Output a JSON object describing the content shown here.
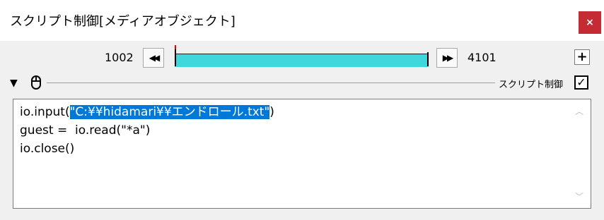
{
  "window": {
    "title": "スクリプト制御[メディアオブジェクト]",
    "close_label": "×"
  },
  "timeline": {
    "start_frame": "1002",
    "end_frame": "4101",
    "fill_fraction": 1.0,
    "rewind_glyph": "◀◀",
    "forward_glyph": "▶▶",
    "add_label": "+",
    "fill_color": "#3fd7dc",
    "marker_color": "#e00000"
  },
  "section": {
    "expand_glyph": "▼",
    "script_control_label": "スクリプト制御",
    "checkbox_glyph": "✓",
    "checked": true
  },
  "editor": {
    "line1_prefix": "io.input(",
    "line1_selected": "\"C:¥¥hidamari¥¥エンドロール.txt\"",
    "line1_suffix": ")",
    "line2": "guest =  io.read(\"*a\")",
    "line3": "io.close()",
    "selection_color": "#0078d7"
  },
  "icons": {
    "close": "close-icon",
    "rewind": "rewind-icon",
    "forward": "forward-icon",
    "add": "plus-icon",
    "expand": "triangle-down-icon",
    "mouse": "mouse-icon",
    "check": "checkmark-icon",
    "scroll_up": "chevron-up-icon",
    "scroll_down": "chevron-down-icon"
  }
}
